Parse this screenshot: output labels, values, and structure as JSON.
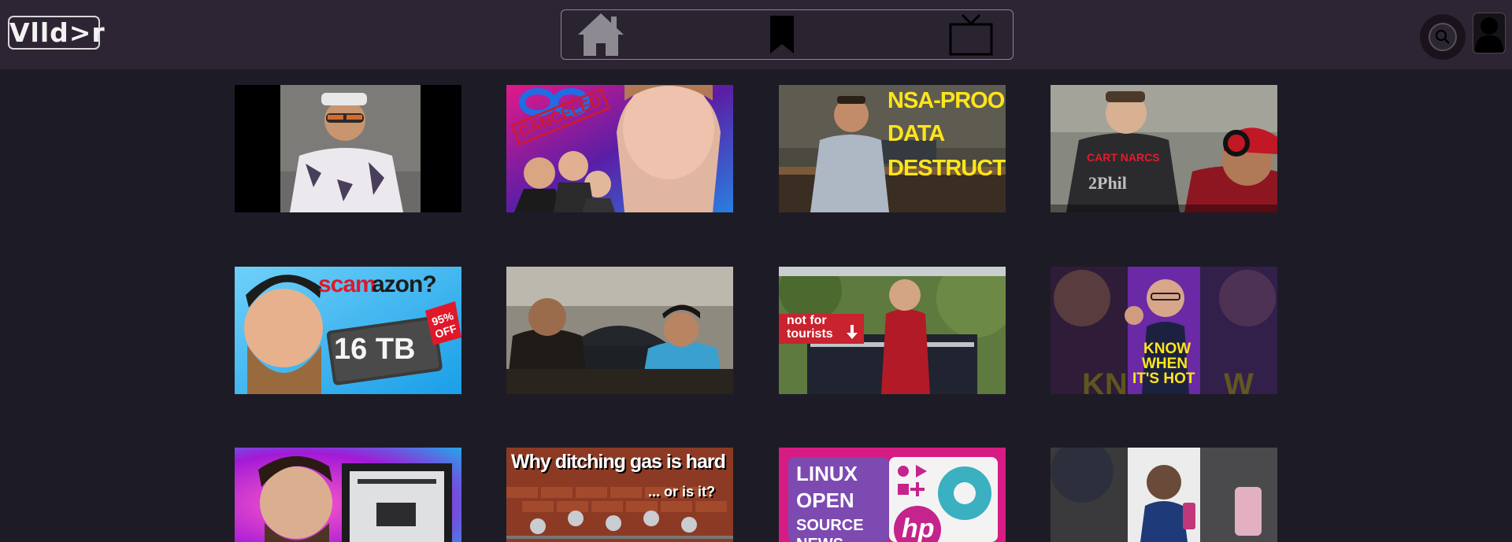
{
  "header": {
    "logo_text": "Vlld>r",
    "nav": [
      {
        "icon": "home-icon"
      },
      {
        "icon": "bookmark-icon"
      },
      {
        "icon": "tv-icon"
      }
    ],
    "search_icon": "search-icon",
    "avatar_icon": "user-icon"
  },
  "colors": {
    "background": "#1d1c26",
    "header": "#2e2534",
    "accent": "#8c8494"
  },
  "videos": [
    {
      "thumb_text": ""
    },
    {
      "thumb_text": "CANCELED"
    },
    {
      "thumb_text": [
        "NSA-PROOF",
        "DATA",
        "DESTRUCTION"
      ]
    },
    {
      "thumb_text": [
        "CART NARCS",
        "2Phil"
      ]
    },
    {
      "thumb_text": [
        "scam",
        "azon?",
        "16 TB",
        "95%",
        "OFF"
      ]
    },
    {
      "thumb_text": ""
    },
    {
      "thumb_text": [
        "not for",
        "tourists"
      ]
    },
    {
      "thumb_text": [
        "KNOW",
        "WHEN",
        "IT'S HOT",
        "KN",
        "W"
      ]
    },
    {
      "thumb_text": ""
    },
    {
      "thumb_text": [
        "Why ditching gas is hard",
        "... or is it?"
      ]
    },
    {
      "thumb_text": [
        "LINUX",
        "OPEN",
        "SOURCE",
        "NEWS",
        "hp"
      ]
    },
    {
      "thumb_text": ""
    }
  ]
}
